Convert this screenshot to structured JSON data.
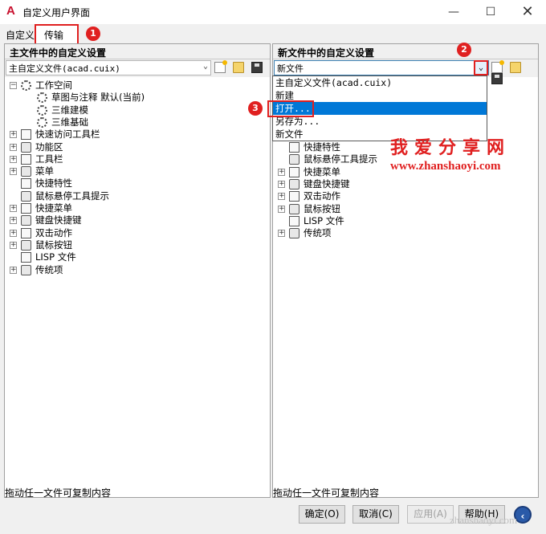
{
  "window": {
    "title": "自定义用户界面",
    "app_icon": "A",
    "minimize": "—",
    "maximize": "☐",
    "close": "✕"
  },
  "tabs": {
    "customize": "自定义",
    "transfer": "传输"
  },
  "annotations": {
    "step1": "1",
    "step2": "2",
    "step3": "3"
  },
  "left_panel": {
    "header": "主文件中的自定义设置",
    "combo_value": "主自定义文件(acad.cuix)",
    "tree": [
      {
        "label": "工作空间",
        "toggle": "−",
        "icon": "gear-icon"
      },
      {
        "label": "草图与注释 默认(当前)",
        "icon": "gear-icon"
      },
      {
        "label": "三维建模",
        "icon": "gear-icon"
      },
      {
        "label": "三维基础",
        "icon": "gear-icon"
      },
      {
        "label": "快速访问工具栏",
        "toggle": "+",
        "icon": "toolbar-icon"
      },
      {
        "label": "功能区",
        "toggle": "+",
        "icon": "ribbon-icon"
      },
      {
        "label": "工具栏",
        "toggle": "+",
        "icon": "toolbar-icon"
      },
      {
        "label": "菜单",
        "toggle": "+",
        "icon": "menu-icon"
      },
      {
        "label": "快捷特性",
        "icon": "quick-properties-icon"
      },
      {
        "label": "鼠标悬停工具提示",
        "icon": "tooltip-icon"
      },
      {
        "label": "快捷菜单",
        "toggle": "+",
        "icon": "shortcut-menu-icon"
      },
      {
        "label": "键盘快捷键",
        "toggle": "+",
        "icon": "keyboard-icon"
      },
      {
        "label": "双击动作",
        "toggle": "+",
        "icon": "mouse-icon"
      },
      {
        "label": "鼠标按钮",
        "toggle": "+",
        "icon": "mouse-icon"
      },
      {
        "label": "LISP 文件",
        "icon": "lisp-file-icon"
      },
      {
        "label": "传统项",
        "toggle": "+",
        "icon": "legacy-icon"
      }
    ],
    "footer_hint": "拖动任一文件可复制内容"
  },
  "right_panel": {
    "header": "新文件中的自定义设置",
    "combo_value": "新文件",
    "dropdown_options": [
      "主自定义文件(acad.cuix)",
      "新建",
      "打开...",
      "另存为...",
      "新文件"
    ],
    "selected_option_index": 2,
    "tree": [
      {
        "label": "快捷特性",
        "icon": "quick-properties-icon"
      },
      {
        "label": "鼠标悬停工具提示",
        "icon": "tooltip-icon"
      },
      {
        "label": "快捷菜单",
        "toggle": "+",
        "icon": "shortcut-menu-icon"
      },
      {
        "label": "键盘快捷键",
        "toggle": "+",
        "icon": "keyboard-icon"
      },
      {
        "label": "双击动作",
        "toggle": "+",
        "icon": "mouse-icon"
      },
      {
        "label": "鼠标按钮",
        "toggle": "+",
        "icon": "mouse-icon"
      },
      {
        "label": "LISP 文件",
        "icon": "lisp-file-icon"
      },
      {
        "label": "传统项",
        "toggle": "+",
        "icon": "legacy-icon"
      }
    ],
    "footer_hint": "拖动任一文件可复制内容"
  },
  "watermark": {
    "cn": "我爱分享网",
    "url": "www.zhanshaoyi.com",
    "footer": "zhanshaoyi.com"
  },
  "buttons": {
    "ok": "确定(O)",
    "cancel": "取消(C)",
    "apply": "应用(A)",
    "help": "帮助(H)",
    "nav": "‹"
  },
  "colors": {
    "accent": "#e02020",
    "selection": "#0078d7"
  }
}
